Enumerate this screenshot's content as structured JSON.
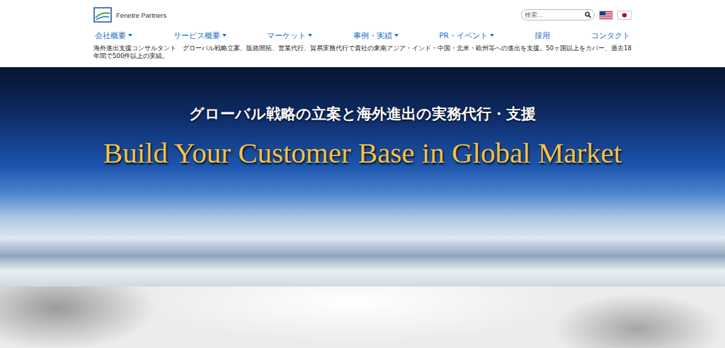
{
  "header": {
    "logo": {
      "text": "Fenetre Partners"
    },
    "search": {
      "placeholder": "検索…"
    }
  },
  "nav": [
    {
      "label": "会社概要",
      "dropdown": true
    },
    {
      "label": "サービス概要",
      "dropdown": true
    },
    {
      "label": "マーケット",
      "dropdown": true
    },
    {
      "label": "事例・実績",
      "dropdown": true
    },
    {
      "label": "PR・イベント",
      "dropdown": true
    },
    {
      "label": "採用",
      "dropdown": false
    },
    {
      "label": "コンタクト",
      "dropdown": false
    }
  ],
  "tagline": "海外進出支援コンサルタント　グローバル戦略立案、販路開拓、営業代行、貿易実務代行で貴社の東南アジア・インド・中国・北米・欧州等への進出を支援。50ヶ国以上をカバー、過去18年間で500件以上の実績。",
  "hero": {
    "subtitle": "グローバル戦略の立案と海外進出の実務代行・支援",
    "title": "Build Your Customer Base in Global Market"
  }
}
